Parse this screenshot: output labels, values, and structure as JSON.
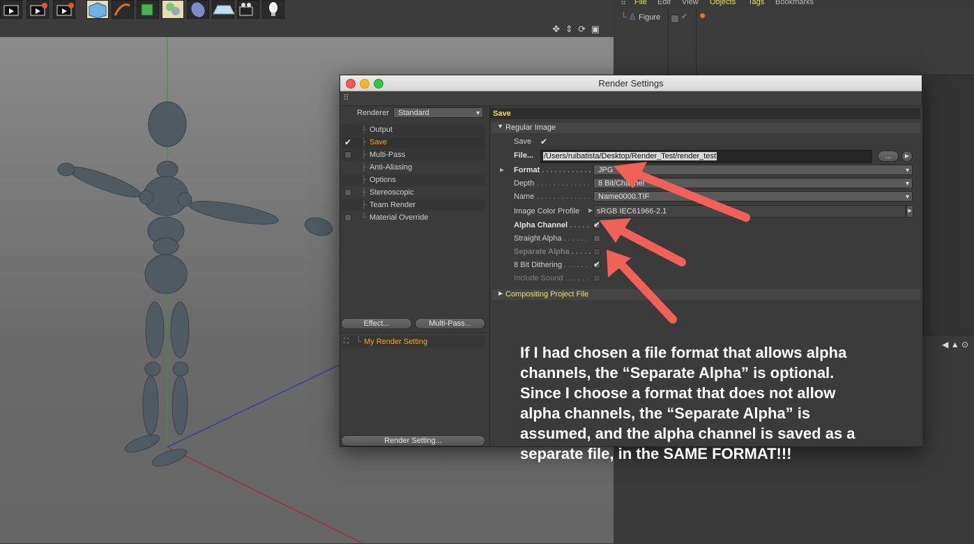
{
  "object_manager": {
    "menu": [
      "File",
      "Edit",
      "View",
      "Objects",
      "Tags",
      "Bookmarks"
    ],
    "object_name": "Figure"
  },
  "dialog": {
    "title": "Render Settings",
    "renderer_label": "Renderer",
    "renderer_value": "Standard",
    "tree": [
      {
        "label": "Output",
        "checkbox": false,
        "checked": false,
        "active": false
      },
      {
        "label": "Save",
        "checkbox": true,
        "checked": true,
        "active": true
      },
      {
        "label": "Multi-Pass",
        "checkbox": true,
        "checked": false,
        "active": false
      },
      {
        "label": "Anti-Aliasing",
        "checkbox": false,
        "checked": false,
        "active": false
      },
      {
        "label": "Options",
        "checkbox": false,
        "checked": false,
        "active": false
      },
      {
        "label": "Stereoscopic",
        "checkbox": true,
        "checked": false,
        "active": false
      },
      {
        "label": "Team Render",
        "checkbox": false,
        "checked": false,
        "active": false
      },
      {
        "label": "Material Override",
        "checkbox": true,
        "checked": false,
        "active": false
      }
    ],
    "effect_button": "Effect...",
    "multipass_button": "Multi-Pass...",
    "render_setting_item": "My Render Setting",
    "render_setting_button": "Render Setting...",
    "panel_title": "Save",
    "section_regular": "Regular Image",
    "save_label": "Save",
    "file_label": "File...",
    "file_path": "/Users/ruibatista/Desktop/Render_Test/render_test",
    "browse_button": "...",
    "format_label": "Format",
    "format_value": "JPG",
    "depth_label": "Depth",
    "depth_value": "8 Bit/Channel",
    "name_label": "Name",
    "name_value": "Name0000.TIF",
    "profile_label": "Image Color Profile",
    "profile_value": "sRGB IEC61966-2.1",
    "alpha_channel_label": "Alpha Channel",
    "straight_alpha_label": "Straight Alpha",
    "separate_alpha_label": "Separate Alpha",
    "dithering_label": "8 Bit Dithering",
    "include_sound_label": "Include Sound",
    "section_compositing": "Compositing Project File"
  },
  "annotation": {
    "lines": [
      "If I had chosen a file format that allows alpha",
      "channels, the “Separate Alpha” is optional.",
      "Since I choose a format that does not allow",
      "alpha channels, the “Separate Alpha” is",
      "assumed, and the alpha channel is saved as a",
      "separate file, in the SAME FORMAT!!!"
    ]
  },
  "colors": {
    "accent_orange": "#f5a623",
    "arrow_red": "#f26157",
    "annotation_text": "#ffffff"
  }
}
